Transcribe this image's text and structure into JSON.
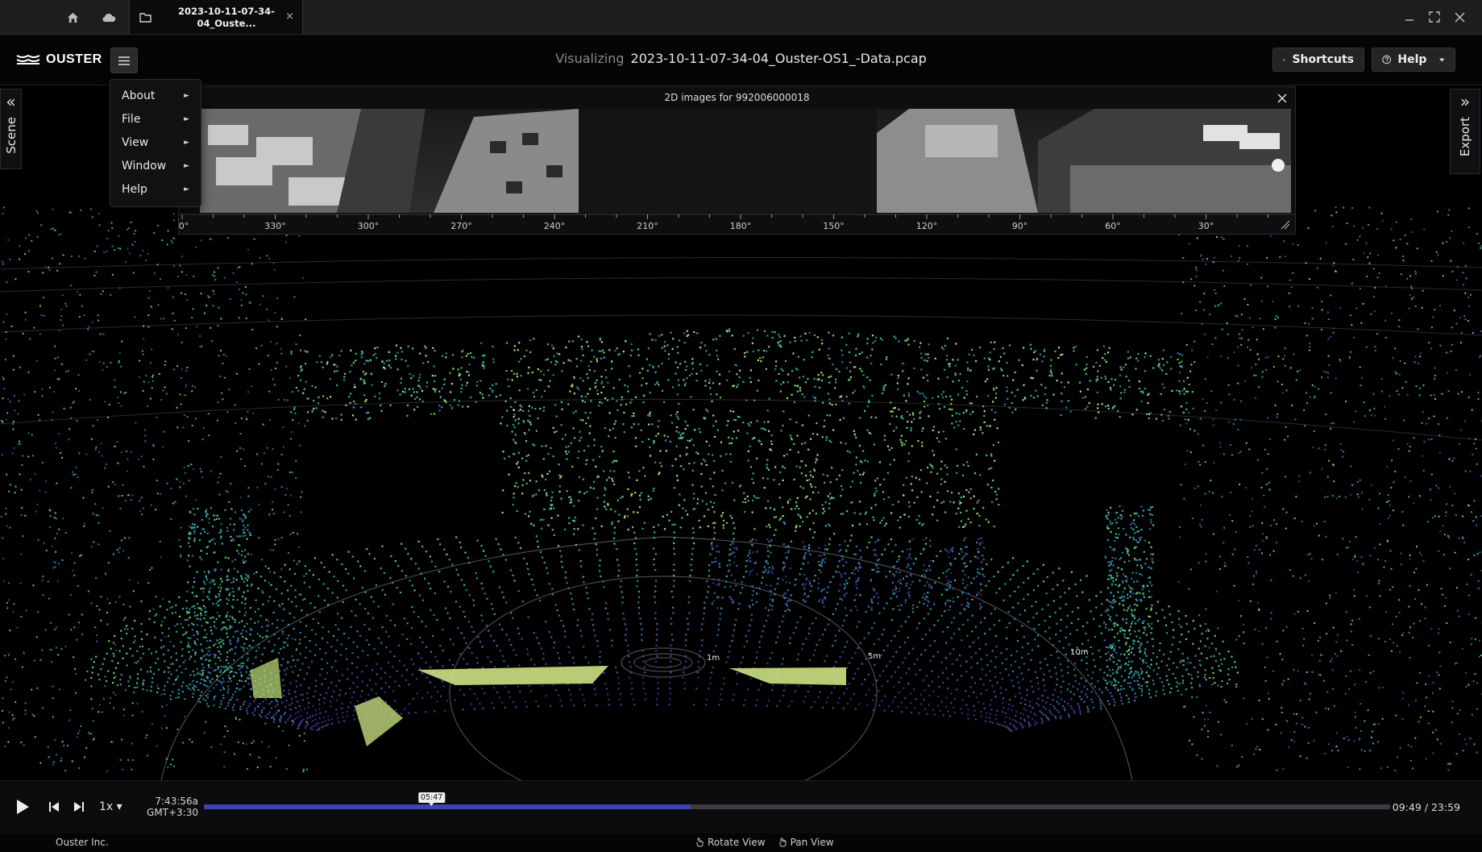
{
  "tab": {
    "title": "2023-10-11-07-34-04_Ouste...",
    "close": "×"
  },
  "titlebar": {
    "icons": [
      "home-icon",
      "cloud-icon",
      "folder-icon"
    ],
    "window_controls": [
      "minimize-icon",
      "maximize-icon",
      "close-icon"
    ]
  },
  "header": {
    "logo": "OUSTER",
    "visualizing_label": "Visualizing",
    "filename": "2023-10-11-07-34-04_Ouster-OS1_-Data.pcap",
    "shortcuts_label": "Shortcuts",
    "help_label": "Help"
  },
  "menu": {
    "items": [
      {
        "label": "About",
        "arrow": "►"
      },
      {
        "label": "File",
        "arrow": "►"
      },
      {
        "label": "View",
        "arrow": "►"
      },
      {
        "label": "Window",
        "arrow": "►"
      },
      {
        "label": "Help",
        "arrow": "►"
      }
    ]
  },
  "side_panels": {
    "left_label": "Scene",
    "left_chevron": "«",
    "right_label": "Export",
    "right_chevron": "»"
  },
  "image_panel": {
    "title": "2D images for 992006000018",
    "axis_labels": [
      "0°",
      "330°",
      "300°",
      "270°",
      "240°",
      "210°",
      "180°",
      "150°",
      "120°",
      "90°",
      "60°",
      "30°"
    ]
  },
  "range_rings": [
    "1m",
    "5m",
    "10m"
  ],
  "playback": {
    "speed": "1x ▾",
    "clock_time": "7:43:56a",
    "clock_zone": "GMT+3:30",
    "thumb_label": "05:47",
    "progress_fraction": 0.41,
    "time_display": "09:49 / 23:59"
  },
  "status": {
    "company": "Ouster Inc.",
    "rotate_view": "Rotate View",
    "pan_view": "Pan View"
  },
  "colors": {
    "accent": "#3c44b0",
    "background": "#000000",
    "panel": "#0e0e10"
  }
}
